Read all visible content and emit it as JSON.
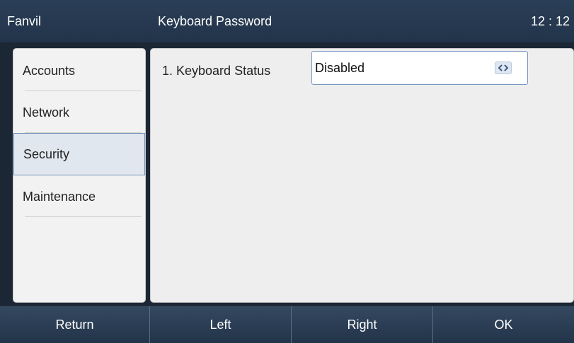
{
  "topbar": {
    "brand": "Fanvil",
    "title": "Keyboard Password",
    "time": "12 : 12"
  },
  "sidebar": {
    "items": [
      {
        "label": "Accounts",
        "selected": false
      },
      {
        "label": "Network",
        "selected": false
      },
      {
        "label": "Security",
        "selected": true
      },
      {
        "label": "Maintenance",
        "selected": false
      }
    ]
  },
  "content": {
    "fields": [
      {
        "label": "1. Keyboard Status",
        "value": "Disabled",
        "icon": "left-right-arrows-icon"
      }
    ]
  },
  "softkeys": [
    "Return",
    "Left",
    "Right",
    "OK"
  ],
  "colors": {
    "topbar_bg": "#23364b",
    "panel_bg": "#eeeeee",
    "selected_border": "#6e8fb6",
    "select_border": "#7a98bf"
  }
}
